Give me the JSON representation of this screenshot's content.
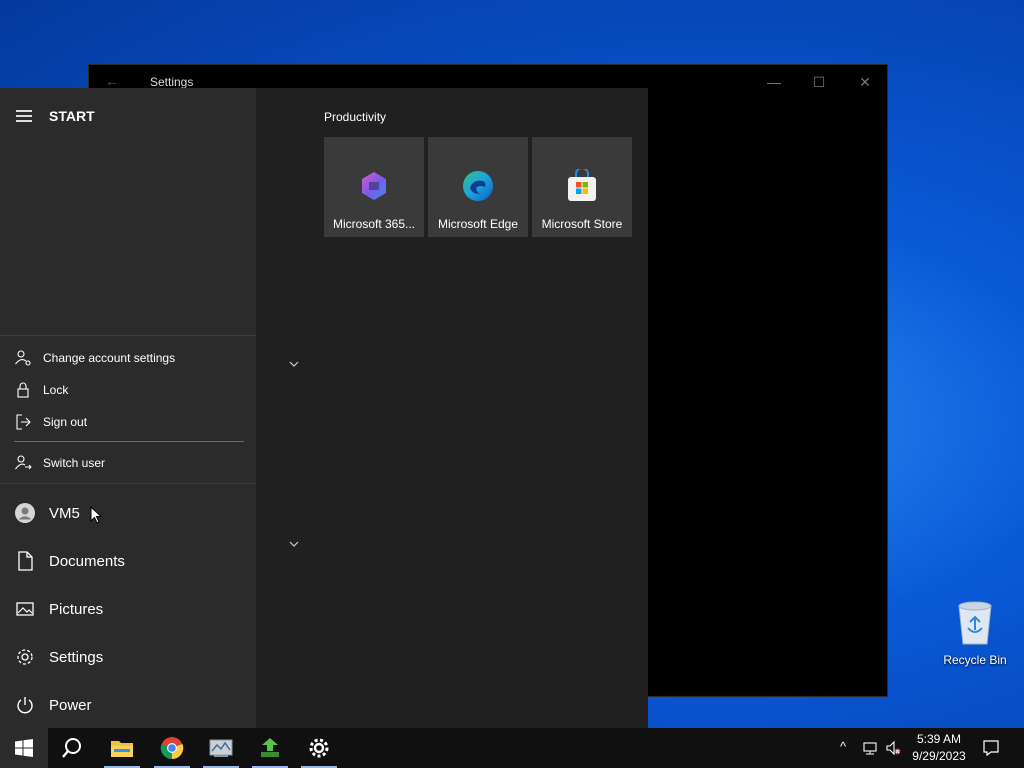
{
  "settings_window": {
    "title": "Settings",
    "back_glyph": "←",
    "minimize_glyph": "—",
    "maximize_glyph": "☐",
    "close_glyph": "✕"
  },
  "start_menu": {
    "header": "START",
    "account_flyout": {
      "items": [
        {
          "label": "Change account settings",
          "icon": "person-gear-icon"
        },
        {
          "label": "Lock",
          "icon": "lock-icon"
        },
        {
          "label": "Sign out",
          "icon": "sign-out-icon"
        },
        {
          "label": "Switch user",
          "icon": "switch-user-icon"
        }
      ]
    },
    "nav": [
      {
        "label": "VM5",
        "icon": "avatar"
      },
      {
        "label": "Documents",
        "icon": "document-icon"
      },
      {
        "label": "Pictures",
        "icon": "pictures-icon"
      },
      {
        "label": "Settings",
        "icon": "gear-icon"
      },
      {
        "label": "Power",
        "icon": "power-icon"
      }
    ],
    "group": {
      "title": "Productivity",
      "tiles": [
        {
          "label": "Microsoft 365...",
          "icon": "microsoft-365-icon"
        },
        {
          "label": "Microsoft Edge",
          "icon": "edge-icon"
        },
        {
          "label": "Microsoft Store",
          "icon": "store-icon"
        }
      ]
    }
  },
  "desktop": {
    "recycle_bin_label": "Recycle Bin"
  },
  "taskbar": {
    "apps": [
      "windows-start-icon",
      "search-icon",
      "file-explorer-icon",
      "chrome-icon",
      "network-tool-icon",
      "green-app-icon",
      "settings-gear-icon"
    ],
    "clock_time": "5:39 AM",
    "clock_date": "9/29/2023",
    "tray_overflow_glyph": "^"
  }
}
